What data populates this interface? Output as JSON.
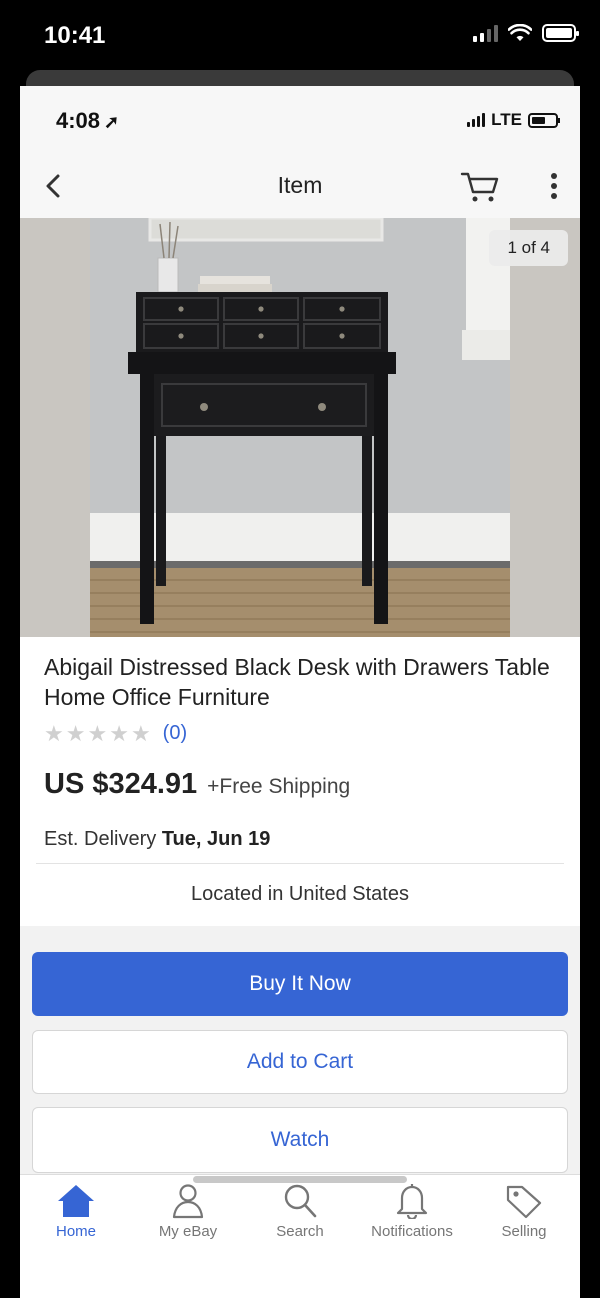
{
  "device": {
    "time": "10:41"
  },
  "screen": {
    "time": "4:08",
    "network": "LTE"
  },
  "nav": {
    "title": "Item"
  },
  "listing": {
    "image_counter": "1 of 4",
    "title": "Abigail Distressed Black Desk with Drawers Table Home Office Furniture",
    "rating_count": "(0)",
    "stars_filled": 0,
    "stars_total": 5,
    "price": "US $324.91",
    "shipping": "+Free Shipping",
    "delivery_label": "Est. Delivery",
    "delivery_date": "Tue, Jun 19",
    "location": "Located in United States"
  },
  "actions": {
    "buy_now": "Buy It Now",
    "add_to_cart": "Add to Cart",
    "watch": "Watch"
  },
  "tabs": [
    {
      "label": "Home",
      "icon": "home-icon",
      "active": true
    },
    {
      "label": "My eBay",
      "icon": "person-icon",
      "active": false
    },
    {
      "label": "Search",
      "icon": "search-icon",
      "active": false
    },
    {
      "label": "Notifications",
      "icon": "bell-icon",
      "active": false
    },
    {
      "label": "Selling",
      "icon": "tag-icon",
      "active": false
    }
  ],
  "colors": {
    "accent": "#3665d4",
    "inactive": "#767676"
  }
}
